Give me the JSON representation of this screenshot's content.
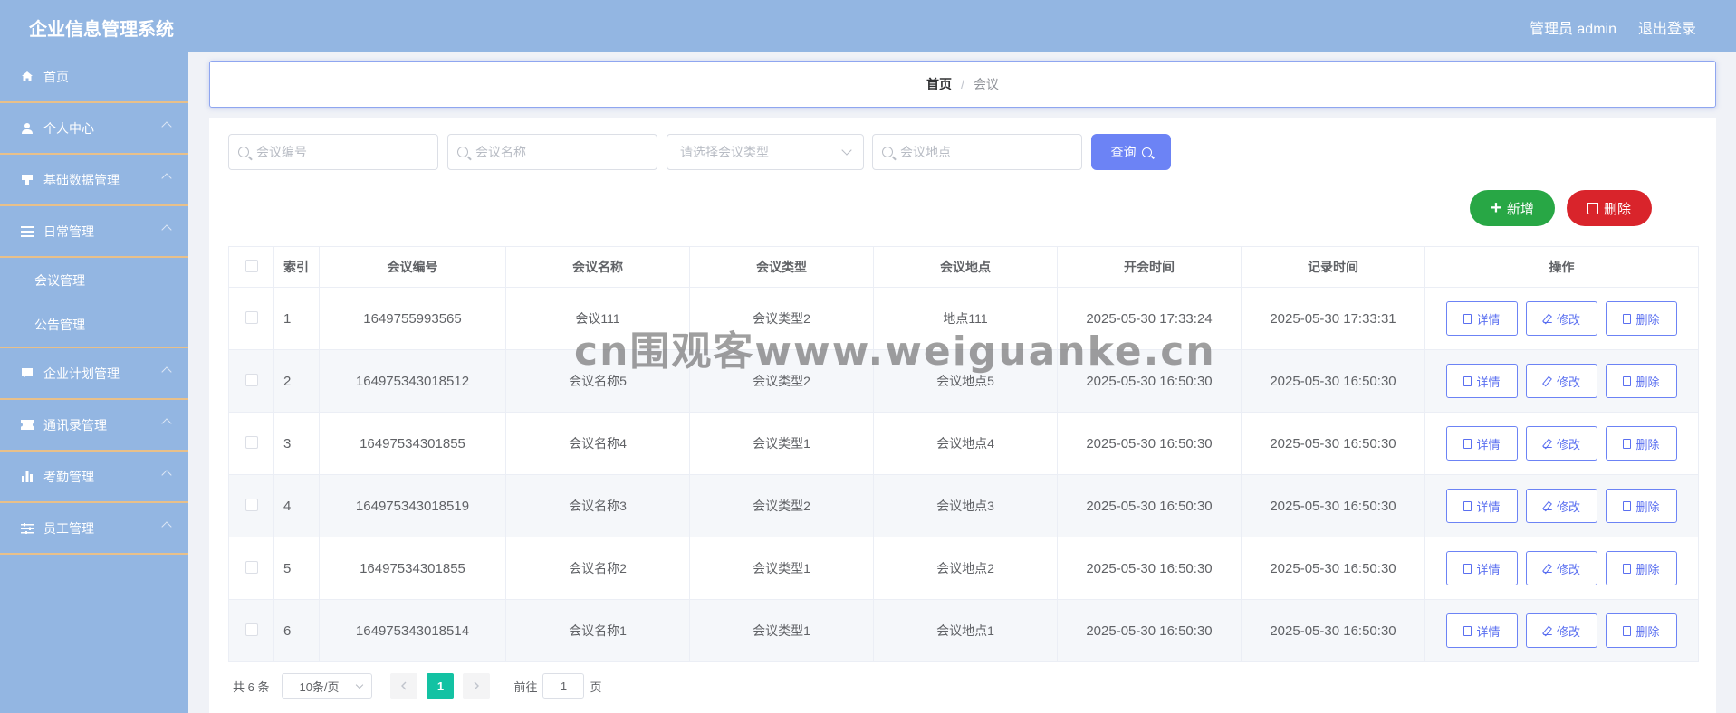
{
  "header": {
    "title": "企业信息管理系统",
    "user": "管理员 admin",
    "logout": "退出登录"
  },
  "sidebar": {
    "items": [
      {
        "label": "首页",
        "icon": "home-icon"
      },
      {
        "label": "个人中心",
        "icon": "user-icon"
      },
      {
        "label": "基础数据管理",
        "icon": "stamp-icon"
      },
      {
        "label": "日常管理",
        "icon": "list-icon"
      },
      {
        "label": "企业计划管理",
        "icon": "chat-icon"
      },
      {
        "label": "通讯录管理",
        "icon": "ticket-icon"
      },
      {
        "label": "考勤管理",
        "icon": "bar-chart-icon"
      },
      {
        "label": "员工管理",
        "icon": "sliders-icon"
      }
    ],
    "subitems": [
      "会议管理",
      "公告管理"
    ]
  },
  "breadcrumb": {
    "home": "首页",
    "separator": "/",
    "current": "会议"
  },
  "search": {
    "number_placeholder": "会议编号",
    "name_placeholder": "会议名称",
    "type_placeholder": "请选择会议类型",
    "location_placeholder": "会议地点",
    "query_label": "查询"
  },
  "actions": {
    "add_label": "新增",
    "delete_label": "删除"
  },
  "table": {
    "headers": [
      "索引",
      "会议编号",
      "会议名称",
      "会议类型",
      "会议地点",
      "开会时间",
      "记录时间",
      "操作"
    ],
    "rows": [
      {
        "index": "1",
        "number": "1649755993565",
        "name": "会议111",
        "type": "会议类型2",
        "location": "地点111",
        "meeting_time": "2025-05-30 17:33:24",
        "record_time": "2025-05-30 17:33:31"
      },
      {
        "index": "2",
        "number": "164975343018512",
        "name": "会议名称5",
        "type": "会议类型2",
        "location": "会议地点5",
        "meeting_time": "2025-05-30 16:50:30",
        "record_time": "2025-05-30 16:50:30"
      },
      {
        "index": "3",
        "number": "16497534301855",
        "name": "会议名称4",
        "type": "会议类型1",
        "location": "会议地点4",
        "meeting_time": "2025-05-30 16:50:30",
        "record_time": "2025-05-30 16:50:30"
      },
      {
        "index": "4",
        "number": "164975343018519",
        "name": "会议名称3",
        "type": "会议类型2",
        "location": "会议地点3",
        "meeting_time": "2025-05-30 16:50:30",
        "record_time": "2025-05-30 16:50:30"
      },
      {
        "index": "5",
        "number": "16497534301855",
        "name": "会议名称2",
        "type": "会议类型1",
        "location": "会议地点2",
        "meeting_time": "2025-05-30 16:50:30",
        "record_time": "2025-05-30 16:50:30"
      },
      {
        "index": "6",
        "number": "164975343018514",
        "name": "会议名称1",
        "type": "会议类型1",
        "location": "会议地点1",
        "meeting_time": "2025-05-30 16:50:30",
        "record_time": "2025-05-30 16:50:30"
      }
    ],
    "op_detail": "详情",
    "op_edit": "修改",
    "op_delete": "删除"
  },
  "pagination": {
    "total": "共 6 条",
    "page_size": "10条/页",
    "current_page": "1",
    "goto_prefix": "前往",
    "goto_value": "1",
    "goto_suffix": "页"
  },
  "watermark": "cn围观客www.weiguanke.cn",
  "colors": {
    "header_bg": "#93b6e2",
    "accent": "#6c83f5",
    "add": "#28a745",
    "delete": "#d9242b",
    "page_active": "#13c2a3"
  }
}
